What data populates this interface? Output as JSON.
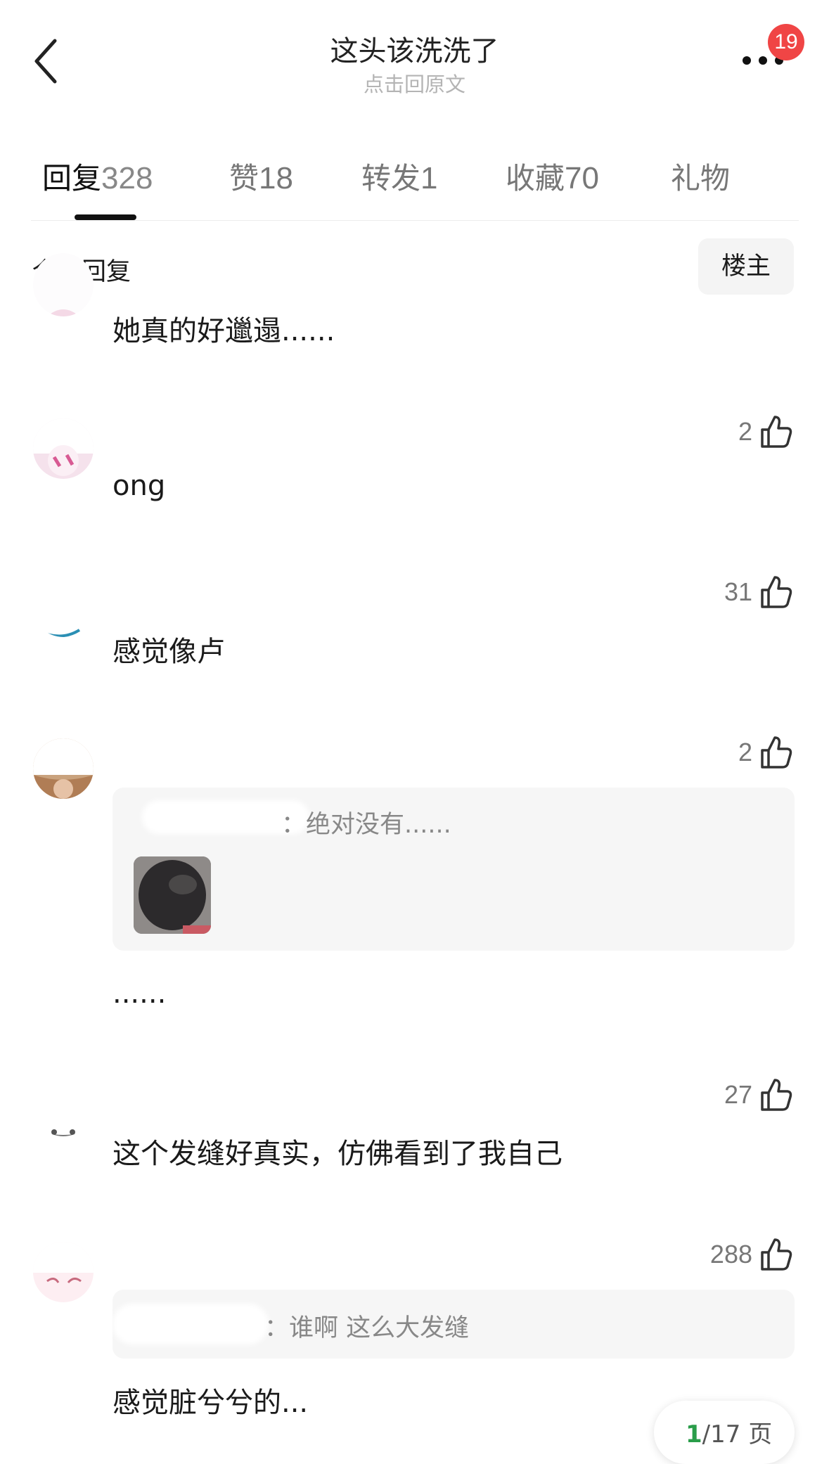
{
  "header": {
    "back_icon": "chevron-left-icon",
    "title": "这头该洗洗了",
    "subtitle": "点击回原文",
    "more_icon": "more-horizontal-icon",
    "badge": "19"
  },
  "tabs": [
    {
      "label": "回复",
      "count": "328",
      "active": true
    },
    {
      "label": "赞",
      "count": "18"
    },
    {
      "label": "转发",
      "count": "1"
    },
    {
      "label": "收藏",
      "count": "70"
    },
    {
      "label": "礼物",
      "count": ""
    }
  ],
  "section": {
    "title": "全部回复",
    "filter_button": "楼主"
  },
  "comments": [
    {
      "text": "她真的好邋遢......",
      "likes": "2"
    },
    {
      "text": "ong",
      "likes": "31"
    },
    {
      "text": "感觉像卢",
      "likes": "2"
    },
    {
      "quote_text": "：绝对没有......",
      "text": "......",
      "likes": "27"
    },
    {
      "text": "这个发缝好真实，仿佛看到了我自己",
      "likes": "288"
    },
    {
      "quote_text": "：谁啊 这么大发缝",
      "text": "感觉脏兮兮的..."
    }
  ],
  "pager": {
    "current": "1",
    "total": "/17 页"
  },
  "colors": {
    "badge": "#f04545",
    "pager_current": "#2a9d4a"
  }
}
